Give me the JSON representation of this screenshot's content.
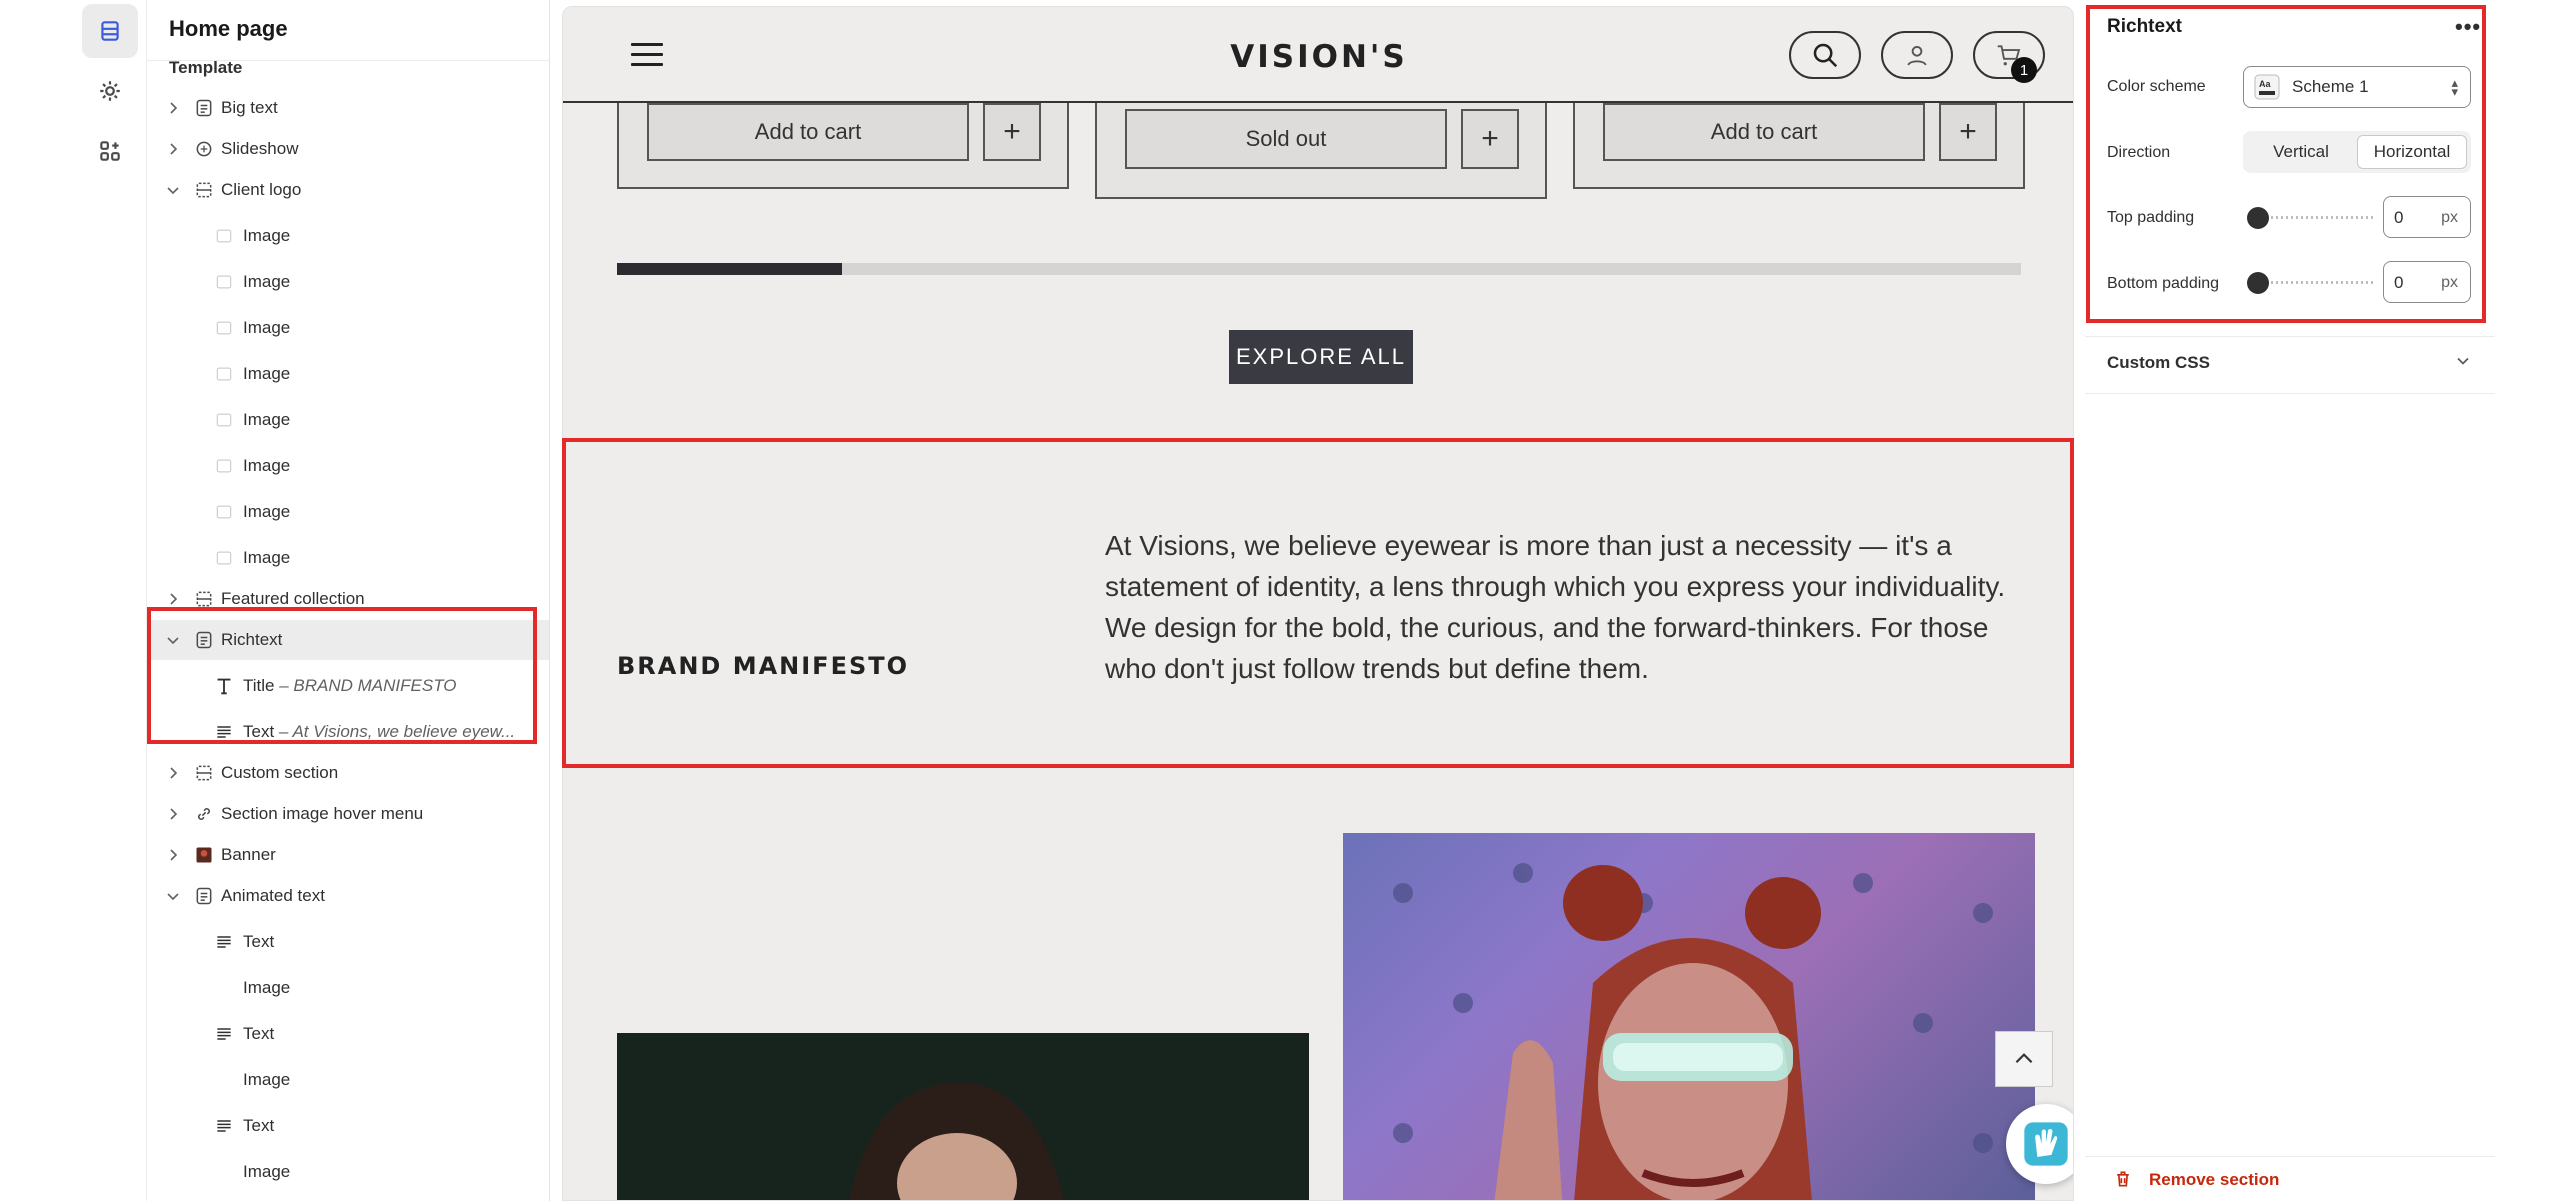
{
  "sidebar": {
    "title": "Home page",
    "group_label": "Template",
    "items": [
      {
        "label": "Big text"
      },
      {
        "label": "Slideshow"
      },
      {
        "label": "Client logo"
      },
      {
        "label": "Image"
      },
      {
        "label": "Image"
      },
      {
        "label": "Image"
      },
      {
        "label": "Image"
      },
      {
        "label": "Image"
      },
      {
        "label": "Image"
      },
      {
        "label": "Image"
      },
      {
        "label": "Image"
      },
      {
        "label": "Featured collection"
      },
      {
        "label": "Richtext"
      },
      {
        "label": "Title",
        "sub": " – BRAND MANIFESTO"
      },
      {
        "label": "Text",
        "sub": " – At Visions, we believe eyew..."
      },
      {
        "label": "Custom section"
      },
      {
        "label": "Section image hover menu"
      },
      {
        "label": "Banner"
      },
      {
        "label": "Animated text"
      },
      {
        "label": "Text"
      },
      {
        "label": "Image"
      },
      {
        "label": "Text"
      },
      {
        "label": "Image"
      },
      {
        "label": "Text"
      },
      {
        "label": "Image"
      }
    ]
  },
  "store": {
    "logo": "VISION'S",
    "cart_count": "1",
    "cards": [
      {
        "button": "Add to cart",
        "plus": "+"
      },
      {
        "button": "Sold out",
        "plus": "+"
      },
      {
        "button": "Add to cart",
        "plus": "+"
      }
    ],
    "progress": 0.16,
    "explore_label": "EXPLORE ALL",
    "manifesto": {
      "title": "BRAND MANIFESTO",
      "text": "At Visions, we believe eyewear is more than just a necessity — it's a statement of identity, a lens through which you express your individuality. We design for the bold, the curious, and the forward-thinkers. For those who don't just follow trends but define them."
    }
  },
  "settings": {
    "title": "Richtext",
    "more": "•••",
    "color_scheme_label": "Color scheme",
    "color_scheme_value": "Scheme 1",
    "direction_label": "Direction",
    "direction_options": [
      "Vertical",
      "Horizontal"
    ],
    "direction_selected": "Horizontal",
    "top_padding_label": "Top padding",
    "top_padding_value": "0",
    "bottom_padding_label": "Bottom padding",
    "bottom_padding_value": "0",
    "unit": "px",
    "custom_css_label": "Custom CSS",
    "remove_label": "Remove section"
  },
  "colors": {
    "highlight": "#e32a2a",
    "preview_bg": "#eeedeb",
    "remove": "#c5280c"
  }
}
